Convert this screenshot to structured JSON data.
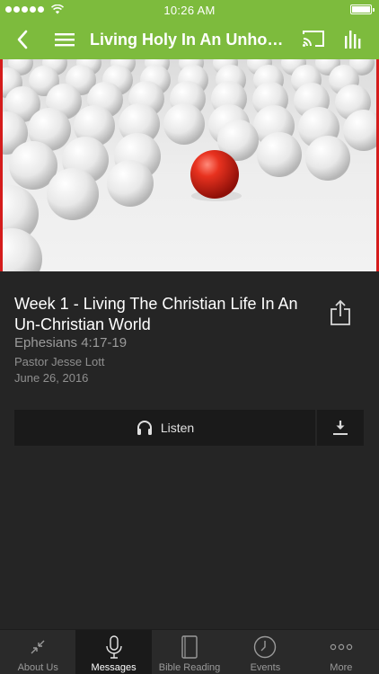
{
  "status_bar": {
    "time": "10:26 AM"
  },
  "nav": {
    "title": "Living Holy In An Unholy..."
  },
  "sermon": {
    "title": "Week 1 - Living The Christian Life In An Un-Christian World",
    "reference": "Ephesians 4:17-19",
    "speaker": "Pastor Jesse Lott",
    "date": "June 26, 2016"
  },
  "actions": {
    "listen_label": "Listen"
  },
  "tabs": [
    {
      "label": "About Us",
      "icon": "compress-icon"
    },
    {
      "label": "Messages",
      "icon": "microphone-icon"
    },
    {
      "label": "Bible Reading",
      "icon": "book-icon"
    },
    {
      "label": "Events",
      "icon": "clock-icon"
    },
    {
      "label": "More",
      "icon": "more-dots-icon"
    }
  ],
  "colors": {
    "brand": "#7dbb3d",
    "accent_red": "#d51c1c",
    "background": "#252525"
  }
}
